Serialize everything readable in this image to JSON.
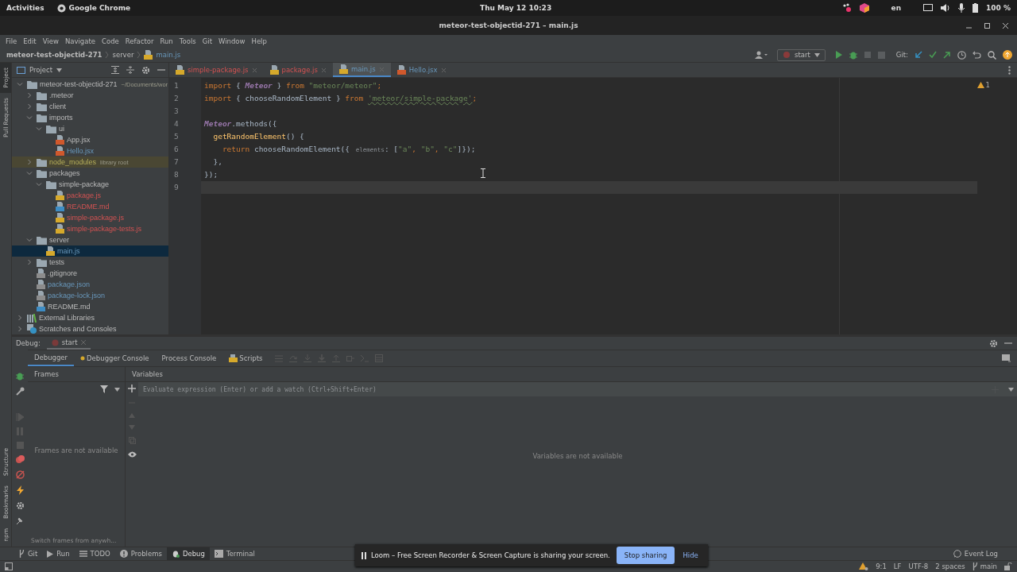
{
  "system_bar": {
    "activities": "Activities",
    "app": "Google Chrome",
    "clock": "Thu May 12  10:23",
    "language": "en",
    "battery": "100 %"
  },
  "window": {
    "title": "meteor-test-objectid-271 – main.js"
  },
  "menu": [
    "File",
    "Edit",
    "View",
    "Navigate",
    "Code",
    "Refactor",
    "Run",
    "Tools",
    "Git",
    "Window",
    "Help"
  ],
  "breadcrumb": [
    {
      "label": "meteor-test-objectid-271",
      "kind": "project"
    },
    {
      "label": "server",
      "kind": "folder"
    },
    {
      "label": "main.js",
      "kind": "file"
    }
  ],
  "toolbar": {
    "run_config": "start",
    "git_label": "Git:"
  },
  "side_tabs_top": [
    {
      "label": "Project",
      "selected": true
    },
    {
      "label": "Pull Requests",
      "selected": false
    }
  ],
  "side_tabs_bottom": [
    {
      "label": "Structure",
      "selected": false
    },
    {
      "label": "Bookmarks",
      "selected": false
    },
    {
      "label": "npm",
      "selected": false
    }
  ],
  "project_panel": {
    "title": "Project",
    "tree": [
      {
        "label": "meteor-test-objectid-271",
        "hint": "~/Documents/wor",
        "kind": "folder",
        "expanded": true,
        "selected": false,
        "modified": false,
        "unversioned": false,
        "excluded": false,
        "children": [
          {
            "label": ".meteor",
            "kind": "folder",
            "expanded": false,
            "selected": false,
            "modified": false,
            "unversioned": false,
            "excluded": false
          },
          {
            "label": "client",
            "kind": "folder",
            "expanded": false,
            "selected": false,
            "modified": false,
            "unversioned": false,
            "excluded": false
          },
          {
            "label": "imports",
            "kind": "folder",
            "expanded": true,
            "selected": false,
            "modified": false,
            "unversioned": false,
            "excluded": false,
            "children": [
              {
                "label": "ui",
                "kind": "folder",
                "expanded": true,
                "selected": false,
                "modified": false,
                "unversioned": false,
                "excluded": false,
                "children": [
                  {
                    "label": "App.jsx",
                    "kind": "jsx",
                    "selected": false,
                    "modified": false,
                    "unversioned": false,
                    "excluded": false
                  },
                  {
                    "label": "Hello.jsx",
                    "kind": "jsx",
                    "selected": false,
                    "modified": true,
                    "unversioned": false,
                    "excluded": false
                  }
                ]
              }
            ]
          },
          {
            "label": "node_modules",
            "hint": "library root",
            "kind": "folder",
            "expanded": false,
            "selected": false,
            "modified": false,
            "unversioned": false,
            "excluded": true
          },
          {
            "label": "packages",
            "kind": "folder",
            "expanded": true,
            "selected": false,
            "modified": false,
            "unversioned": false,
            "excluded": false,
            "children": [
              {
                "label": "simple-package",
                "kind": "folder",
                "expanded": true,
                "selected": false,
                "modified": false,
                "unversioned": false,
                "excluded": false,
                "children": [
                  {
                    "label": "package.js",
                    "kind": "js",
                    "selected": false,
                    "modified": false,
                    "unversioned": true,
                    "excluded": false
                  },
                  {
                    "label": "README.md",
                    "kind": "md",
                    "selected": false,
                    "modified": false,
                    "unversioned": true,
                    "excluded": false
                  },
                  {
                    "label": "simple-package.js",
                    "kind": "js",
                    "selected": false,
                    "modified": false,
                    "unversioned": true,
                    "excluded": false
                  },
                  {
                    "label": "simple-package-tests.js",
                    "kind": "js",
                    "selected": false,
                    "modified": false,
                    "unversioned": true,
                    "excluded": false
                  }
                ]
              }
            ]
          },
          {
            "label": "server",
            "kind": "folder",
            "expanded": true,
            "selected": false,
            "modified": false,
            "unversioned": false,
            "excluded": false,
            "children": [
              {
                "label": "main.js",
                "kind": "js",
                "selected": true,
                "modified": true,
                "unversioned": false,
                "excluded": false
              }
            ]
          },
          {
            "label": "tests",
            "kind": "folder",
            "expanded": false,
            "selected": false,
            "modified": false,
            "unversioned": false,
            "excluded": false
          },
          {
            "label": ".gitignore",
            "kind": "text",
            "selected": false,
            "modified": false,
            "unversioned": false,
            "excluded": false
          },
          {
            "label": "package.json",
            "kind": "json",
            "selected": false,
            "modified": true,
            "unversioned": false,
            "excluded": false
          },
          {
            "label": "package-lock.json",
            "kind": "json",
            "selected": false,
            "modified": true,
            "unversioned": false,
            "excluded": false
          },
          {
            "label": "README.md",
            "kind": "md",
            "selected": false,
            "modified": false,
            "unversioned": false,
            "excluded": false
          }
        ]
      },
      {
        "label": "External Libraries",
        "kind": "library",
        "expanded": false,
        "selected": false,
        "modified": false,
        "unversioned": false,
        "excluded": false
      },
      {
        "label": "Scratches and Consoles",
        "kind": "scratches",
        "expanded": false,
        "selected": false,
        "modified": false,
        "unversioned": false,
        "excluded": false
      }
    ]
  },
  "editor_tabs": [
    {
      "label": "simple-package.js",
      "kind": "js",
      "selected": false,
      "modified": false,
      "unversioned": true
    },
    {
      "label": "package.js",
      "kind": "js",
      "selected": false,
      "modified": false,
      "unversioned": true
    },
    {
      "label": "main.js",
      "kind": "js",
      "selected": true,
      "modified": true,
      "unversioned": false
    },
    {
      "label": "Hello.jsx",
      "kind": "jsx",
      "selected": false,
      "modified": true,
      "unversioned": false
    }
  ],
  "editor": {
    "warning_count": "1",
    "lines": [
      {
        "number": "1",
        "current": false,
        "tokens": [
          {
            "text": "import",
            "kind": "kw"
          },
          {
            "text": " { ",
            "kind": "plain"
          },
          {
            "text": "Meteor",
            "kind": "cls"
          },
          {
            "text": " } ",
            "kind": "plain"
          },
          {
            "text": "from",
            "kind": "kw"
          },
          {
            "text": " \"meteor/meteor\"",
            "kind": "str"
          },
          {
            "text": ";",
            "kind": "kw"
          }
        ]
      },
      {
        "number": "2",
        "current": false,
        "tokens": [
          {
            "text": "import",
            "kind": "kw"
          },
          {
            "text": " { chooseRandomElement } ",
            "kind": "plain"
          },
          {
            "text": "from ",
            "kind": "kw"
          },
          {
            "text": "'meteor/simple-package'",
            "kind": "strwarn"
          },
          {
            "text": ";",
            "kind": "kw"
          }
        ]
      },
      {
        "number": "3",
        "current": false
      },
      {
        "number": "4",
        "current": false,
        "tokens": [
          {
            "text": "Meteor",
            "kind": "cls"
          },
          {
            "text": ".methods({",
            "kind": "plain"
          }
        ]
      },
      {
        "number": "5",
        "current": false,
        "tokens": [
          {
            "text": "  getRandomElement",
            "kind": "fn"
          },
          {
            "text": "() {",
            "kind": "plain"
          }
        ]
      },
      {
        "number": "6",
        "current": false,
        "tokens": [
          {
            "text": "    return",
            "kind": "kw"
          },
          {
            "text": " chooseRandomElement({ ",
            "kind": "plain"
          },
          {
            "text": "elements",
            "kind": "hint"
          },
          {
            "text": ": [",
            "kind": "plain"
          },
          {
            "text": "\"a\"",
            "kind": "str"
          },
          {
            "text": ", ",
            "kind": "kw"
          },
          {
            "text": "\"b\"",
            "kind": "str"
          },
          {
            "text": ", ",
            "kind": "kw"
          },
          {
            "text": "\"c\"",
            "kind": "str"
          },
          {
            "text": "]});",
            "kind": "plain"
          }
        ]
      },
      {
        "number": "7",
        "current": false,
        "tokens": [
          {
            "text": "  },",
            "kind": "plain"
          }
        ]
      },
      {
        "number": "8",
        "current": false,
        "tokens": [
          {
            "text": "});",
            "kind": "plain"
          }
        ]
      },
      {
        "number": "9",
        "current": true
      }
    ]
  },
  "debug": {
    "label": "Debug:",
    "session": "start",
    "tabs": [
      {
        "label": "Debugger",
        "kind": "plain",
        "selected": true
      },
      {
        "label": "Debugger Console",
        "kind": "console",
        "selected": false
      },
      {
        "label": "Process Console",
        "kind": "plain",
        "selected": false
      },
      {
        "label": "Scripts",
        "kind": "scripts",
        "selected": false
      }
    ],
    "frames": {
      "title": "Frames",
      "empty": "Frames are not available",
      "tip": "Switch frames from anywh..."
    },
    "variables": {
      "title": "Variables",
      "placeholder": "Evaluate expression (Enter) or add a watch (Ctrl+Shift+Enter)",
      "empty": "Variables are not available"
    }
  },
  "tool_windows": [
    {
      "label": "Git",
      "kind": "git",
      "selected": false
    },
    {
      "label": "Run",
      "kind": "run",
      "selected": false
    },
    {
      "label": "TODO",
      "kind": "todo",
      "selected": false
    },
    {
      "label": "Problems",
      "kind": "problems",
      "selected": false
    },
    {
      "label": "Debug",
      "kind": "debug",
      "selected": true
    },
    {
      "label": "Terminal",
      "kind": "terminal",
      "selected": false
    }
  ],
  "event_log": "Event Log",
  "notification": {
    "message": "Loom – Free Screen Recorder & Screen Capture is sharing your screen.",
    "primary": "Stop sharing",
    "secondary": "Hide"
  },
  "status_bar": {
    "position": "9:1",
    "line_separator": "LF",
    "encoding": "UTF-8",
    "indent": "2 spaces",
    "branch": "main"
  }
}
